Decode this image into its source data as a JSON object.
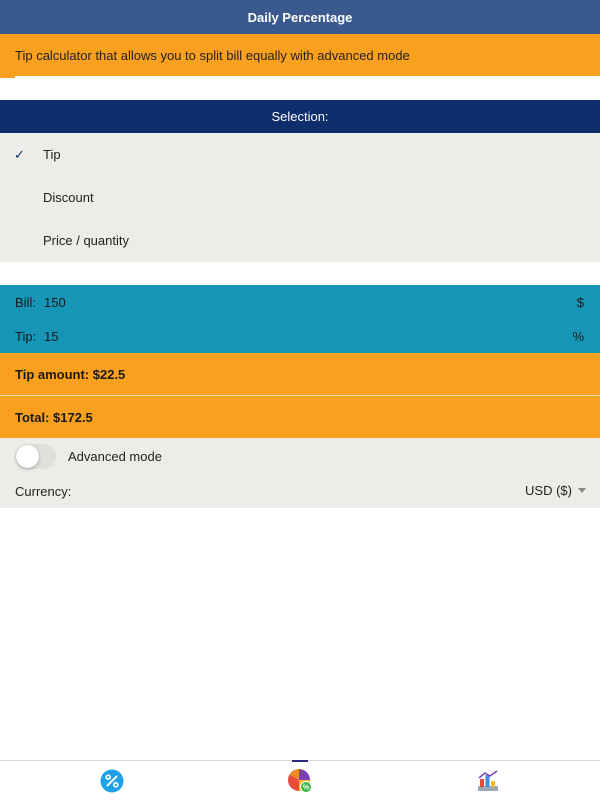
{
  "header": {
    "title": "Daily Percentage"
  },
  "description": "Tip calculator that allows you to split bill equally with advanced mode",
  "selection": {
    "title": "Selection:",
    "items": [
      {
        "label": "Tip",
        "selected": true
      },
      {
        "label": "Discount",
        "selected": false
      },
      {
        "label": "Price / quantity",
        "selected": false
      }
    ]
  },
  "inputs": {
    "bill": {
      "label": "Bill:",
      "value": "150",
      "unit": "$"
    },
    "tip": {
      "label": "Tip:",
      "value": "15",
      "unit": "%"
    }
  },
  "results": {
    "tip_amount": "Tip amount: $22.5",
    "total": "Total: $172.5"
  },
  "settings": {
    "advanced_mode_label": "Advanced mode",
    "advanced_mode_on": false,
    "currency_label": "Currency:",
    "currency_value": "USD ($)"
  },
  "bottom_nav": {
    "items": [
      {
        "icon": "percent-icon"
      },
      {
        "icon": "pie-chart-icon",
        "active": true
      },
      {
        "icon": "chart-report-icon"
      }
    ]
  },
  "colors": {
    "title_bar": "#3a5a8f",
    "orange": "#f9a01f",
    "navy": "#0d2d6b",
    "teal": "#1795b6",
    "light_gray": "#eeece8"
  }
}
